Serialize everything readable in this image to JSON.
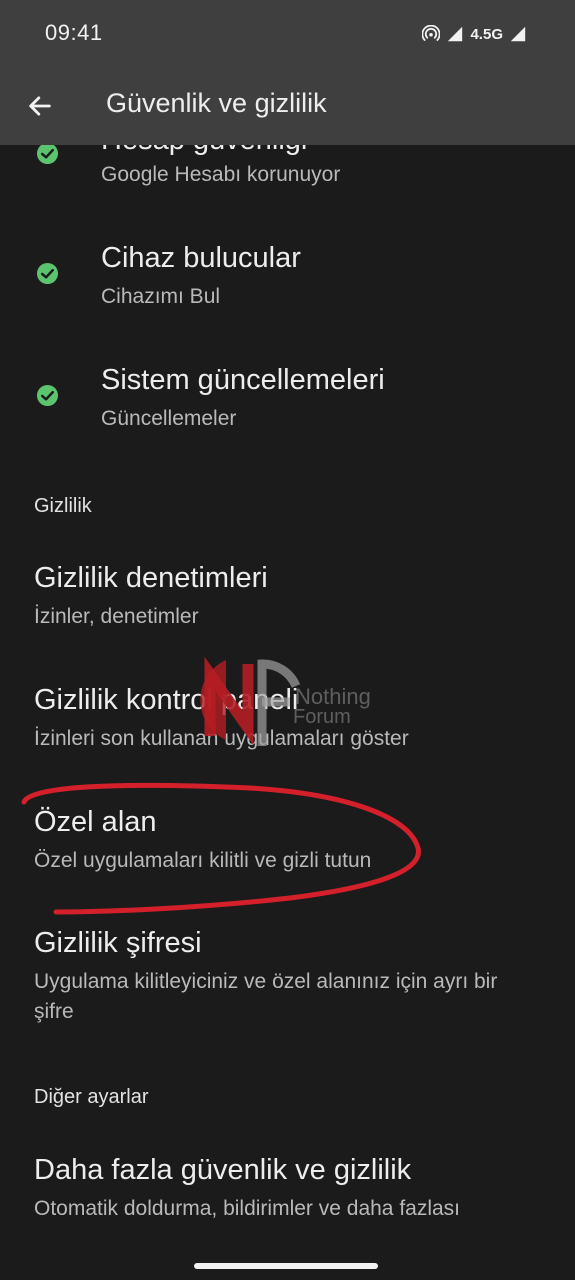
{
  "status_bar": {
    "time": "09:41",
    "network": "4.5G"
  },
  "app_bar": {
    "title": "Güvenlik ve gizlilik",
    "back_icon": "arrow-back-icon"
  },
  "security_items": [
    {
      "title": "Hesap güvenliği",
      "subtitle": "Google Hesabı korunuyor",
      "icon": "check-circle-icon"
    },
    {
      "title": "Cihaz bulucular",
      "subtitle": "Cihazımı Bul",
      "icon": "check-circle-icon"
    },
    {
      "title": "Sistem güncellemeleri",
      "subtitle": "Güncellemeler",
      "icon": "check-circle-icon"
    }
  ],
  "privacy_section": {
    "header": "Gizlilik",
    "items": [
      {
        "title": "Gizlilik denetimleri",
        "subtitle": "İzinler, denetimler"
      },
      {
        "title": "Gizlilik kontrol paneli",
        "subtitle": "İzinleri son kullanan uygulamaları göster"
      },
      {
        "title": "Özel alan",
        "subtitle": "Özel uygulamaları kilitli ve gizli tutun"
      },
      {
        "title": "Gizlilik şifresi",
        "subtitle": "Uygulama kilitleyiciniz ve özel alanınız için ayrı bir şifre"
      }
    ]
  },
  "other_section": {
    "header": "Diğer ayarlar",
    "items": [
      {
        "title": "Daha fazla güvenlik ve gizlilik",
        "subtitle": "Otomatik doldurma, bildirimler ve daha fazlası"
      }
    ]
  },
  "watermark": {
    "line1": "Nothing",
    "line2": "Forum"
  },
  "colors": {
    "background": "#1b1b1b",
    "app_bar": "#3f3f3f",
    "check_green": "#5cc46f",
    "annotation_red": "#d3202a"
  }
}
